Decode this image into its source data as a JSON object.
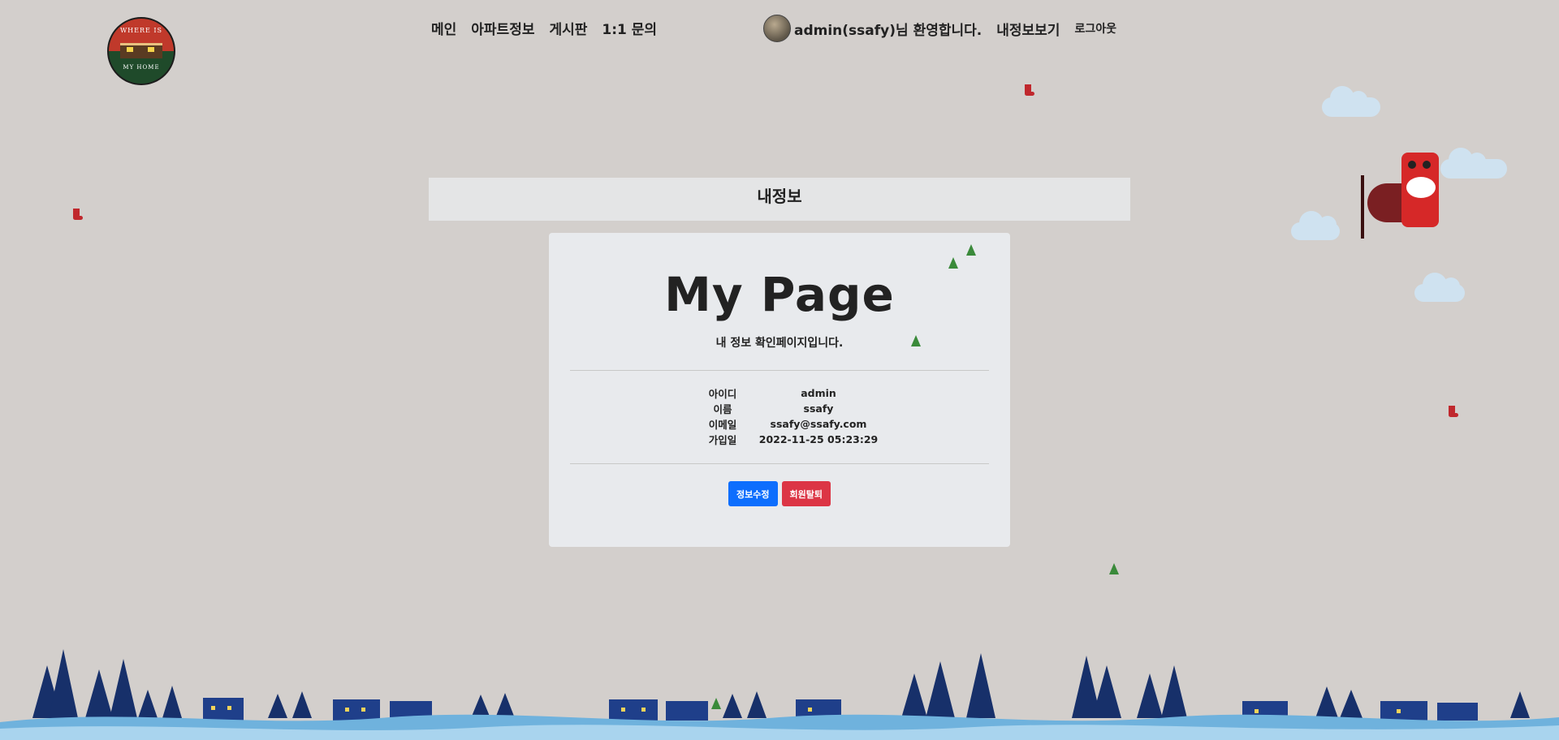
{
  "header": {
    "logo_alt": "WHERE IS MY HOME",
    "logo_text_top": "WHERE IS",
    "logo_text_bottom": "MY HOME",
    "nav": [
      {
        "label": "메인"
      },
      {
        "label": "아파트정보"
      },
      {
        "label": "게시판"
      },
      {
        "label": "1:1 문의"
      }
    ],
    "welcome": "admin(ssafy)님 환영합니다.",
    "my_info_link": "내정보보기",
    "logout_link": "로그아웃"
  },
  "banner": {
    "title": "내정보"
  },
  "card": {
    "title": "My Page",
    "subtitle": "내 정보 확인페이지입니다.",
    "fields": [
      {
        "label": "아이디",
        "value": "admin"
      },
      {
        "label": "이름",
        "value": "ssafy"
      },
      {
        "label": "이메일",
        "value": "ssafy@ssafy.com"
      },
      {
        "label": "가입일",
        "value": "2022-11-25 05:23:29"
      }
    ],
    "edit_button": "정보수정",
    "delete_button": "회원탈퇴"
  },
  "colors": {
    "background": "#d3cfcc",
    "card": "#e8eaed",
    "primary": "#0d6efd",
    "danger": "#dc3545"
  }
}
